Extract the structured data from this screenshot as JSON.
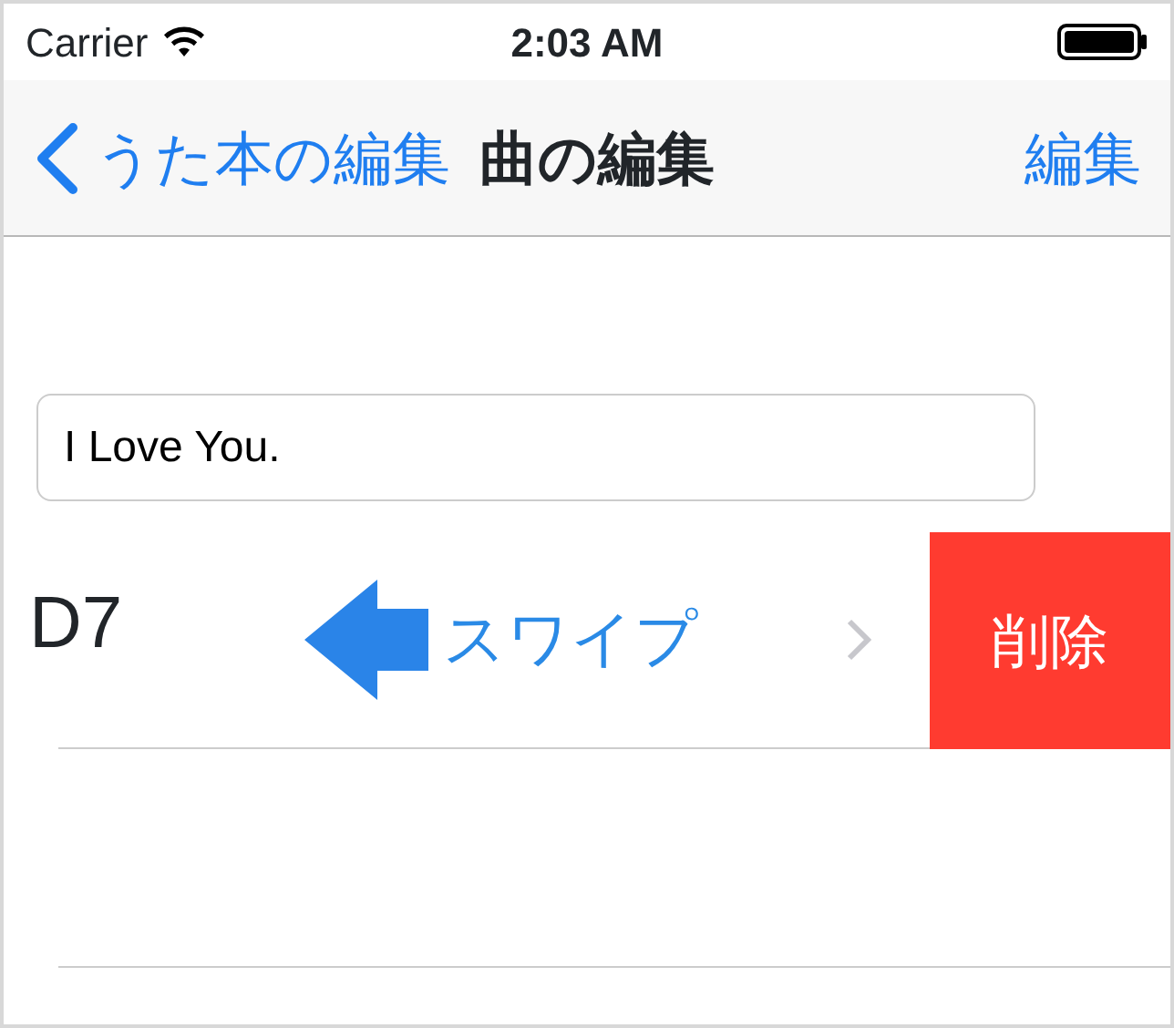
{
  "status_bar": {
    "carrier": "Carrier",
    "time": "2:03 AM"
  },
  "nav_bar": {
    "back_label": "うた本の編集",
    "title": "曲の編集",
    "action": "編集"
  },
  "title_field": {
    "value": "I Love You."
  },
  "rows": [
    {
      "kind": "song",
      "label": "D7",
      "swiped": true,
      "hint": "スワイプ",
      "delete_label": "削除"
    },
    {
      "kind": "empty"
    }
  ]
}
